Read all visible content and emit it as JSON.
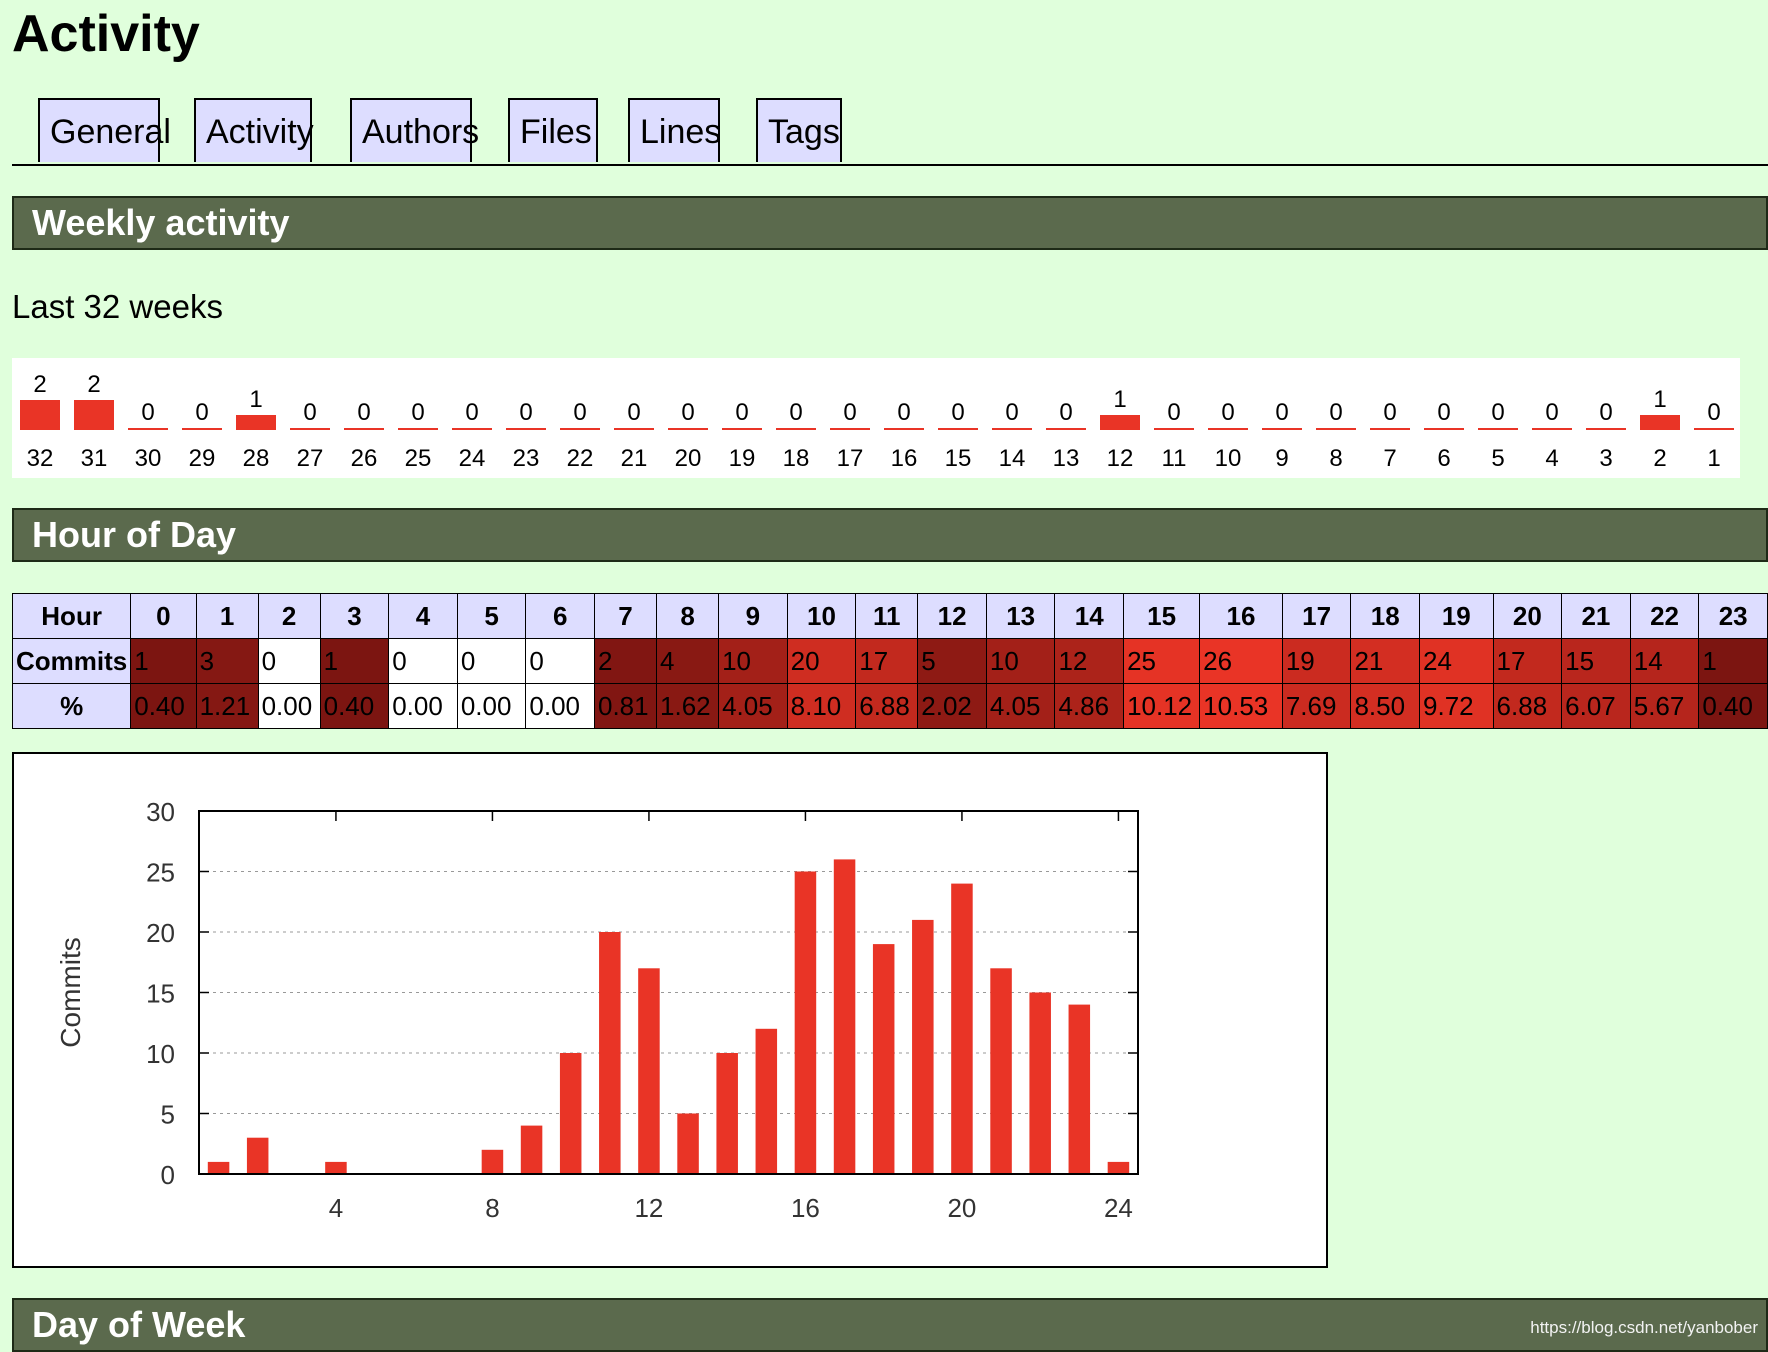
{
  "page_title": "Activity",
  "tabs": [
    {
      "label": "General"
    },
    {
      "label": "Activity"
    },
    {
      "label": "Authors"
    },
    {
      "label": "Files"
    },
    {
      "label": "Lines"
    },
    {
      "label": "Tags"
    }
  ],
  "sections": {
    "weekly": "Weekly activity",
    "hour": "Hour of Day",
    "day": "Day of Week"
  },
  "weekly": {
    "subtitle": "Last 32 weeks",
    "weeks": [
      32,
      31,
      30,
      29,
      28,
      27,
      26,
      25,
      24,
      23,
      22,
      21,
      20,
      19,
      18,
      17,
      16,
      15,
      14,
      13,
      12,
      11,
      10,
      9,
      8,
      7,
      6,
      5,
      4,
      3,
      2,
      1
    ],
    "commits": [
      2,
      2,
      0,
      0,
      1,
      0,
      0,
      0,
      0,
      0,
      0,
      0,
      0,
      0,
      0,
      0,
      0,
      0,
      0,
      0,
      1,
      0,
      0,
      0,
      0,
      0,
      0,
      0,
      0,
      0,
      1,
      0
    ]
  },
  "hour_table": {
    "row_labels": {
      "hour": "Hour",
      "commits": "Commits",
      "percent": "%"
    },
    "hours": [
      "0",
      "1",
      "2",
      "3",
      "4",
      "5",
      "6",
      "7",
      "8",
      "9",
      "10",
      "11",
      "12",
      "13",
      "14",
      "15",
      "16",
      "17",
      "18",
      "19",
      "20",
      "21",
      "22",
      "23"
    ],
    "commits": [
      "1",
      "3",
      "0",
      "1",
      "0",
      "0",
      "0",
      "2",
      "4",
      "10",
      "20",
      "17",
      "5",
      "10",
      "12",
      "25",
      "26",
      "19",
      "21",
      "24",
      "17",
      "15",
      "14",
      "1"
    ],
    "percent": [
      "0.40",
      "1.21",
      "0.00",
      "0.40",
      "0.00",
      "0.00",
      "0.00",
      "0.81",
      "1.62",
      "4.05",
      "8.10",
      "6.88",
      "2.02",
      "4.05",
      "4.86",
      "10.12",
      "10.53",
      "7.69",
      "8.50",
      "9.72",
      "6.88",
      "6.07",
      "5.67",
      "0.40"
    ]
  },
  "chart_data": {
    "type": "bar",
    "x": [
      1,
      2,
      3,
      4,
      5,
      6,
      7,
      8,
      9,
      10,
      11,
      12,
      13,
      14,
      15,
      16,
      17,
      18,
      19,
      20,
      21,
      22,
      23,
      24
    ],
    "values": [
      1,
      3,
      0,
      1,
      0,
      0,
      0,
      2,
      4,
      10,
      20,
      17,
      5,
      10,
      12,
      25,
      26,
      19,
      21,
      24,
      17,
      15,
      14,
      1
    ],
    "ylabel": "Commits",
    "xlabel": "",
    "xlim": [
      0.5,
      24.5
    ],
    "ylim": [
      0,
      30
    ],
    "xticks": [
      4,
      8,
      12,
      16,
      20,
      24
    ],
    "yticks": [
      0,
      5,
      10,
      15,
      20,
      25,
      30
    ],
    "grid": "horizontal dashed",
    "colors": {
      "bar": "#e93426"
    }
  },
  "watermark": "https://blog.csdn.net/yanbober"
}
